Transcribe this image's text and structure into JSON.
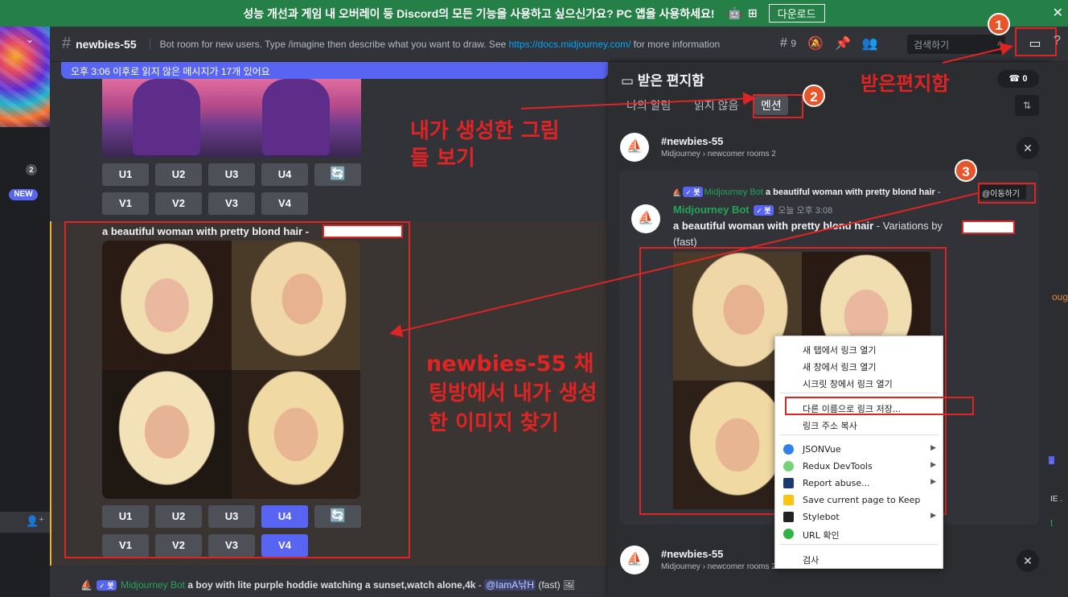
{
  "banner": {
    "text": "성능 개선과 게임 내 오버레이 등 Discord의 모든 기능을 사용하고 싶으신가요? PC 앱을 사용하세요!",
    "download": "다운로드",
    "close": "✕"
  },
  "servers": {
    "badge_count": "2",
    "new_badge": "NEW"
  },
  "header": {
    "channel": "newbies-55",
    "topic_prefix": "Bot room for new users. Type /imagine then describe what you want to draw. See ",
    "topic_link": "https://docs.midjourney.com/",
    "topic_suffix": " for more information",
    "threads_count": "9",
    "search_placeholder": "검색하기"
  },
  "unread_bar": "오후 3:06 이후로 읽지 않은 메시지가 17개 있어요",
  "buttons": {
    "u1": "U1",
    "u2": "U2",
    "u3": "U3",
    "u4": "U4",
    "v1": "V1",
    "v2": "V2",
    "v3": "V3",
    "v4": "V4",
    "reroll": "🔄"
  },
  "message": {
    "prompt": "a beautiful woman with pretty blond hair",
    "dash": " -"
  },
  "bottom_message": {
    "bot_name": "Midjourney Bot",
    "bot_tag": "✓ 봇",
    "prompt": "a boy with lite purple hoddie watching a sunset,watch alone,4k",
    "dash": " - ",
    "mention": "@IamA낚H",
    "suffix": " (fast)"
  },
  "annotations": {
    "n1": "1",
    "n2": "2",
    "n3": "3",
    "inbox_label": "받은편지함",
    "my_images": "내가 생성한 그림",
    "my_images2": "들 보기",
    "find1": "newbies-55 채",
    "find2": "팅방에서 내가 생성",
    "find3": "한 이미지 찾기"
  },
  "inbox": {
    "title": "받은 편지함",
    "tabs": [
      "나의 알림",
      "읽지 않음",
      "멘션"
    ],
    "pill": "0",
    "card1": {
      "channel": "newbies-55",
      "path": "Midjourney › newcomer rooms 2"
    },
    "card2": {
      "channel": "newbies-55",
      "path": "Midjourney › newcomer rooms 2"
    }
  },
  "reply": {
    "bot": "Midjourney Bot",
    "tag": "✓ 봇",
    "prompt": "a beautiful woman with pretty blond hair",
    "dash": " - ",
    "jump": "이동하기"
  },
  "post": {
    "bot": "Midjourney Bot",
    "tag": "✓ 봇",
    "time": "오늘 오후 3:08",
    "prompt": "a beautiful woman with pretty blond hair",
    "rest": " - Variations by",
    "speed": "(fast)"
  },
  "context_menu": {
    "items": [
      "새 탭에서 링크 열기",
      "새 창에서 링크 열기",
      "시크릿 창에서 링크 열기",
      "다른 이름으로 링크 저장...",
      "링크 주소 복사",
      "JSONVue",
      "Redux DevTools",
      "Report abuse...",
      "Save current page to Keep",
      "Stylebot",
      "URL 확인",
      "검사"
    ]
  },
  "right_clip": {
    "a": "oug.",
    "b": "IE .",
    "c": "t"
  }
}
